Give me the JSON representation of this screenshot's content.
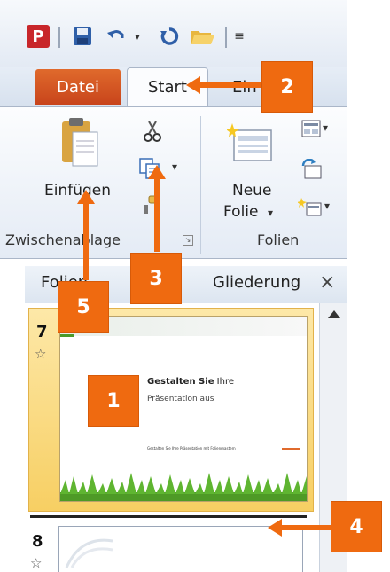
{
  "ribbon": {
    "tabs": {
      "datei": "Datei",
      "start": "Start",
      "einfuegen_partial": "Ein"
    },
    "paste_label": "Einfügen",
    "new_slide_label_line1": "Neue",
    "new_slide_label_line2": "Folie",
    "group_clipboard": "Zwischenablage",
    "group_slides": "Folien"
  },
  "pane": {
    "tab_slides": "Folien",
    "tab_outline": "Gliederung",
    "close": "×"
  },
  "slides": [
    {
      "number": "7",
      "title_bold": "Gestalten Sie",
      "title_rest": " Ihre",
      "subtitle": "Präsentation aus",
      "footer": "Gestalten Sie Ihre Präsentation mit Folienmastern"
    },
    {
      "number": "8"
    }
  ],
  "callouts": [
    "1",
    "2",
    "3",
    "4",
    "5"
  ],
  "icons": [
    "ppt-logo-icon",
    "save-icon",
    "undo-icon",
    "redo-icon",
    "open-folder-icon",
    "qat-customize-icon",
    "paste-icon",
    "cut-icon",
    "copy-icon",
    "format-painter-icon",
    "new-slide-icon",
    "layout-icon",
    "reset-icon",
    "section-icon",
    "star-icon"
  ],
  "colors": {
    "callout": "#ef6a10",
    "file_tab": "#c8441b",
    "selected_slide": "#f7cf63"
  }
}
